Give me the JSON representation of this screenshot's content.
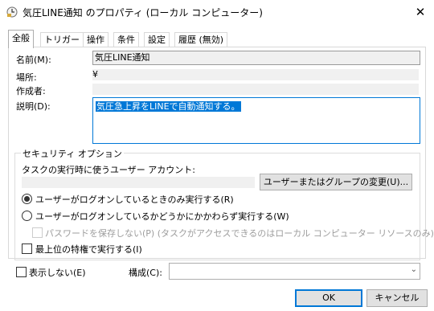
{
  "window": {
    "title": "気圧LINE通知 のプロパティ (ローカル コンピューター)",
    "close_label": "✕"
  },
  "tabs": [
    {
      "label": "全般",
      "active": true
    },
    {
      "label": "トリガー"
    },
    {
      "label": "操作"
    },
    {
      "label": "条件"
    },
    {
      "label": "設定"
    },
    {
      "label": "履歴 (無効)"
    }
  ],
  "general": {
    "name_label": "名前(M):",
    "name_value": "気圧LINE通知",
    "location_label": "場所:",
    "location_value": "¥",
    "author_label": "作成者:",
    "author_value": "",
    "description_label": "説明(D):",
    "description_value": "気圧急上昇をLINEで自動通知する。"
  },
  "security": {
    "legend": "セキュリティ オプション",
    "account_label": "タスクの実行時に使うユーザー アカウント:",
    "account_value": "",
    "change_button": "ユーザーまたはグループの変更(U)...",
    "radio_logged_on": "ユーザーがログオンしているときのみ実行する(R)",
    "radio_any": "ユーザーがログオンしているかどうかにかかわらず実行する(W)",
    "no_store_password": "パスワードを保存しない(P) (タスクがアクセスできるのはローカル コンピューター リソースのみ)",
    "highest_privileges": "最上位の特権で実行する(I)"
  },
  "footer": {
    "hidden_label": "表示しない(E)",
    "configure_label": "構成(C):",
    "configure_value": "",
    "ok_label": "OK",
    "cancel_label": "キャンセル"
  },
  "state": {
    "selected_radio": "logged_on",
    "no_store_password_checked": false,
    "highest_privileges_checked": false,
    "hidden_checked": false
  },
  "colors": {
    "accent": "#0078d7",
    "readonly_bg": "#f0f0f0",
    "button_bg": "#e1e1e1"
  }
}
